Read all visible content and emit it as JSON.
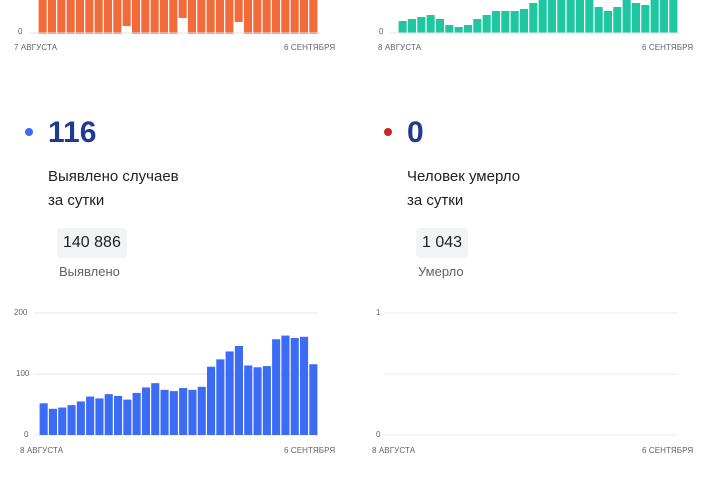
{
  "top_left": {
    "y_tick": "0",
    "x_start": "7 АВГУСТА",
    "x_end": "6 СЕНТЯБРЯ",
    "color": "#f26b3a"
  },
  "top_right": {
    "y_tick": "0",
    "x_start": "8 АВГУСТА",
    "x_end": "6 СЕНТЯБРЯ",
    "color": "#1fc7a1"
  },
  "cases": {
    "value": "116",
    "label_line1": "Выявлено случаев",
    "label_line2": "за сутки",
    "total": "140 886",
    "total_caption": "Выявлено",
    "dot_color": "#3c6cf5",
    "number_color": "#1f3a93"
  },
  "deaths": {
    "value": "0",
    "label_line1": "Человек умерло",
    "label_line2": "за сутки",
    "total": "1 043",
    "total_caption": "Умерло",
    "dot_color": "#c62828",
    "number_color": "#1f3a93"
  },
  "chart_data": [
    {
      "type": "bar",
      "x_start_label": "8 АВГУСТА",
      "x_end_label": "6 СЕНТЯБРЯ",
      "y_ticks": [
        "200",
        "100",
        "0"
      ],
      "ylim": [
        0,
        200
      ],
      "grid": true,
      "color": "#3c6cf5",
      "values": [
        52,
        43,
        45,
        49,
        55,
        63,
        60,
        67,
        64,
        58,
        69,
        78,
        85,
        74,
        72,
        77,
        74,
        79,
        112,
        124,
        137,
        146,
        114,
        111,
        113,
        157,
        163,
        159,
        161,
        116
      ]
    },
    {
      "type": "bar",
      "x_start_label": "8 АВГУСТА",
      "x_end_label": "6 СЕНТЯБРЯ",
      "y_ticks": [
        "1",
        "0"
      ],
      "ylim": [
        0,
        1
      ],
      "grid": true,
      "values": []
    }
  ]
}
